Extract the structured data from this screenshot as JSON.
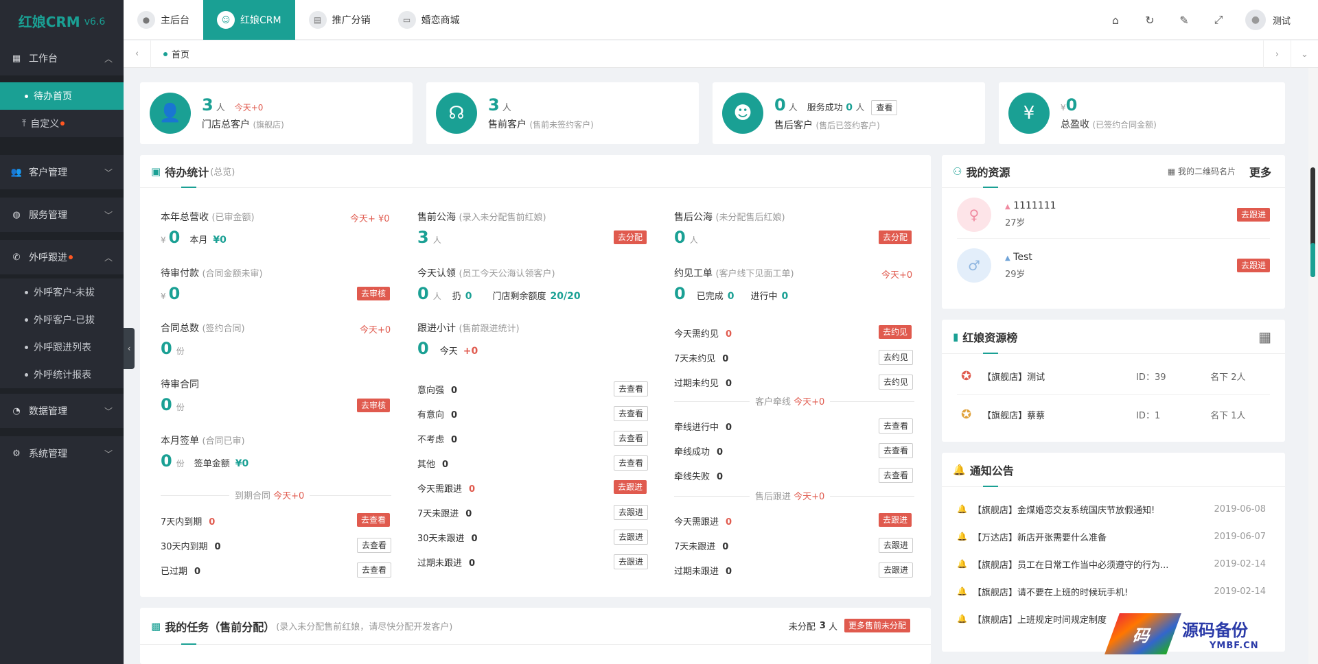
{
  "app": {
    "name": "红娘CRM",
    "version": "v6.6"
  },
  "sidebar": {
    "groups": [
      {
        "label": "工作台"
      },
      {
        "label": "客户管理"
      },
      {
        "label": "服务管理"
      },
      {
        "label": "外呼跟进"
      },
      {
        "label": "数据管理"
      },
      {
        "label": "系统管理"
      }
    ],
    "workbench_items": [
      "待办首页",
      "自定义"
    ],
    "call_items": [
      "外呼客户-未拔",
      "外呼客户-已拔",
      "外呼跟进列表",
      "外呼统计报表"
    ]
  },
  "topnav": [
    "主后台",
    "红娘CRM",
    "推广分销",
    "婚恋商城"
  ],
  "user": {
    "name": "测试"
  },
  "tabs": {
    "home": "首页"
  },
  "stats": [
    {
      "num": "3",
      "unit": "人",
      "today": "今天+0",
      "label": "门店总客户",
      "hint": "(旗舰店)"
    },
    {
      "num": "3",
      "unit": "人",
      "label": "售前客户",
      "hint": "(售前未签约客户)"
    },
    {
      "num": "0",
      "unit": "人",
      "extra": "服务成功",
      "extra_num": "0",
      "extra_unit": "人",
      "btn": "查看",
      "label": "售后客户",
      "hint": "(售后已签约客户)"
    },
    {
      "prefix": "¥",
      "num": "0",
      "label": "总盈收",
      "hint": "(已签约合同金额)"
    }
  ],
  "todo": {
    "title": "待办统计",
    "subtitle": "(总览)",
    "col1": {
      "annual": {
        "label": "本年总营收",
        "hint": "(已审金额)",
        "today": "今天+ ¥0",
        "cur": "¥",
        "num": "0",
        "month_label": "本月",
        "month_val": "¥0"
      },
      "pay": {
        "label": "待审付款",
        "hint": "(合同金额未审)",
        "cur": "¥",
        "num": "0",
        "btn": "去审核"
      },
      "contracts": {
        "label": "合同总数",
        "hint": "(签约合同)",
        "today": "今天+0",
        "num": "0",
        "unit": "份"
      },
      "pending": {
        "label": "待审合同",
        "num": "0",
        "unit": "份",
        "btn": "去审核"
      },
      "monthly": {
        "label": "本月签单",
        "hint": "(合同已审)",
        "num": "0",
        "unit": "份",
        "amt_label": "签单金额",
        "amt_val": "¥0"
      },
      "expire_title": "到期合同",
      "expire_today": "今天+0",
      "expire": [
        {
          "label": "7天内到期",
          "val": "0",
          "btn": "去查看"
        },
        {
          "label": "30天内到期",
          "val": "0",
          "btn": "去查看"
        },
        {
          "label": "已过期",
          "val": "0",
          "btn": "去查看"
        }
      ]
    },
    "col2": {
      "pre_sea": {
        "label": "售前公海",
        "hint": "(录入未分配售前红娘)",
        "num": "3",
        "unit": "人",
        "btn": "去分配"
      },
      "claim": {
        "label": "今天认领",
        "hint": "(员工今天公海认领客户)",
        "num": "0",
        "unit": "人",
        "throw_label": "扔",
        "throw_val": "0",
        "quota_label": "门店剩余额度",
        "quota_val": "20/20"
      },
      "follow": {
        "label": "跟进小计",
        "hint": "(售前跟进统计)",
        "num": "0",
        "today_label": "今天",
        "today_val": "+0"
      },
      "intent": [
        {
          "label": "意向强",
          "val": "0",
          "btn": "去查看"
        },
        {
          "label": "有意向",
          "val": "0",
          "btn": "去查看"
        },
        {
          "label": "不考虑",
          "val": "0",
          "btn": "去查看"
        },
        {
          "label": "其他",
          "val": "0",
          "btn": "去查看"
        }
      ],
      "follows": [
        {
          "label": "今天需跟进",
          "val": "0",
          "btn": "去跟进",
          "primary": true
        },
        {
          "label": "7天未跟进",
          "val": "0",
          "btn": "去跟进"
        },
        {
          "label": "30天未跟进",
          "val": "0",
          "btn": "去跟进"
        },
        {
          "label": "过期未跟进",
          "val": "0",
          "btn": "去跟进"
        }
      ]
    },
    "col3": {
      "post_sea": {
        "label": "售后公海",
        "hint": "(未分配售后红娘)",
        "num": "0",
        "unit": "人",
        "btn": "去分配"
      },
      "appt": {
        "label": "约见工单",
        "hint": "(客户线下见面工单)",
        "today": "今天+0",
        "num": "0",
        "done_label": "已完成",
        "done_val": "0",
        "ing_label": "进行中",
        "ing_val": "0"
      },
      "appts": [
        {
          "label": "今天需约见",
          "val": "0",
          "btn": "去约见",
          "primary": true
        },
        {
          "label": "7天未约见",
          "val": "0",
          "btn": "去约见"
        },
        {
          "label": "过期未约见",
          "val": "0",
          "btn": "去约见"
        }
      ],
      "match_title": "客户牵线",
      "match_today": "今天+0",
      "matches": [
        {
          "label": "牵线进行中",
          "val": "0",
          "btn": "去查看"
        },
        {
          "label": "牵线成功",
          "val": "0",
          "btn": "去查看"
        },
        {
          "label": "牵线失败",
          "val": "0",
          "btn": "去查看"
        }
      ],
      "after_title": "售后跟进",
      "after_today": "今天+0",
      "afters": [
        {
          "label": "今天需跟进",
          "val": "0",
          "btn": "去跟进",
          "primary": true
        },
        {
          "label": "7天未跟进",
          "val": "0",
          "btn": "去跟进"
        },
        {
          "label": "过期未跟进",
          "val": "0",
          "btn": "去跟进"
        }
      ]
    }
  },
  "tasks": {
    "title": "我的任务（售前分配）",
    "subtitle": "(录入未分配售前红娘，请尽快分配开发客户)",
    "unassigned_label": "未分配",
    "unassigned_num": "3",
    "unassigned_unit": "人",
    "btn": "更多售前未分配"
  },
  "resources": {
    "title": "我的资源",
    "qr_label": "我的二维码名片",
    "more": "更多",
    "items": [
      {
        "name": "1111111",
        "age": "27岁",
        "btn": "去跟进"
      },
      {
        "name": "Test",
        "age": "29岁",
        "btn": "去跟进"
      }
    ]
  },
  "ranking": {
    "title": "红娘资源榜",
    "items": [
      {
        "store": "【旗舰店】测试",
        "id": "ID：39",
        "count": "名下 2人"
      },
      {
        "store": "【旗舰店】蔡蔡",
        "id": "ID：1",
        "count": "名下 1人"
      }
    ]
  },
  "notices": {
    "title": "通知公告",
    "items": [
      {
        "text": "【旗舰店】金煤婚恋交友系统国庆节放假通知!",
        "date": "2019-06-08"
      },
      {
        "text": "【万达店】新店开张需要什么准备",
        "date": "2019-06-07"
      },
      {
        "text": "【旗舰店】员工在日常工作当中必须遵守的行为...",
        "date": "2019-02-14"
      },
      {
        "text": "【旗舰店】请不要在上班的时候玩手机!",
        "date": "2019-02-14"
      },
      {
        "text": "【旗舰店】上班规定时间规定制度",
        "date": ""
      }
    ]
  },
  "watermark": {
    "logo": "码",
    "text": "源码备份",
    "url": "YMBF.CN"
  },
  "colors": {
    "accent": "#1aa094",
    "danger": "#e05a4e",
    "sidebar": "#282b33"
  }
}
